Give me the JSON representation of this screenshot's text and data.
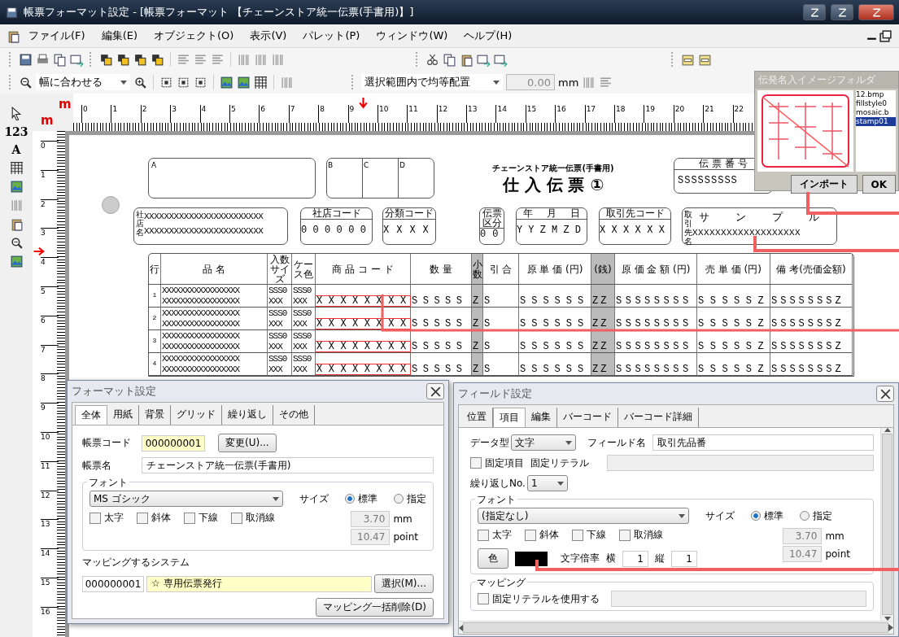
{
  "window": {
    "title": "帳票フォーマット設定 - [帳票フォーマット 【チェーンストア統一伝票(手書用)】]"
  },
  "menu": [
    "ファイル(F)",
    "編集(E)",
    "オブジェクト(O)",
    "表示(V)",
    "パレット(P)",
    "ウィンドウ(W)",
    "ヘルプ(H)"
  ],
  "toolbar": {
    "zoom_mode": "幅に合わせる",
    "distribute_mode": "選択範囲内で均等配置",
    "spacing": "0.00",
    "spacing_unit": "mm"
  },
  "palette": [
    "123",
    "A"
  ],
  "ruler": {
    "unit_marks": [
      "m",
      "m"
    ],
    "horizontal": [
      "0",
      "1",
      "2",
      "3",
      "4",
      "5",
      "6",
      "7",
      "8",
      "9",
      "10",
      "11",
      "12",
      "13",
      "14",
      "15",
      "16",
      "17",
      "18",
      "19",
      "20",
      "21",
      "22"
    ],
    "vertical": [
      "0",
      "1",
      "2",
      "3",
      "4",
      "5",
      "6",
      "7",
      "8",
      "9",
      "10",
      "11",
      "12",
      "13",
      "14",
      "15",
      "16"
    ]
  },
  "form": {
    "subtitle": "チェーンストア統一伝票(手書用)",
    "title": "仕 入 伝 票 ①",
    "corner_boxes": [
      "A",
      "B",
      "C",
      "D"
    ],
    "slip_number": {
      "label": "伝 票 番 号",
      "value": "SSSSSSSSS"
    },
    "store": {
      "label": "社店名",
      "lines": [
        "XXXXXXXXXXXXXXXXXXXXXXXX",
        "XXXXXXXXXXXXXXXXXXXXXXXX"
      ]
    },
    "code_boxes": [
      {
        "headers": [
          "社店コード"
        ],
        "digits": [
          "0",
          "0",
          "0",
          "0",
          "0",
          "0"
        ]
      },
      {
        "headers": [
          "分類コード"
        ],
        "digits": [
          "X",
          "X",
          "X",
          "X"
        ]
      },
      {
        "headers": [
          "伝票区分"
        ],
        "digits": [
          "0",
          "0"
        ]
      },
      {
        "headers": [
          "年",
          "月",
          "日"
        ],
        "digits": [
          "Y",
          "Y",
          "Z",
          "M",
          "Z",
          "D"
        ]
      },
      {
        "headers": [
          "取引先コード"
        ],
        "digits": [
          "X",
          "X",
          "X",
          "X",
          "X",
          "X"
        ]
      }
    ],
    "supplier": {
      "label": "取引先名",
      "sample": "サ ン プ ル",
      "value": "XXXXXXXXXXXXXXXXXXX"
    },
    "columns": [
      {
        "label": "行",
        "selected": false,
        "shaded": false
      },
      {
        "label": "品 名",
        "selected": false,
        "shaded": false
      },
      {
        "label": "入数サイズ",
        "selected": false,
        "shaded": false
      },
      {
        "label": "ケース色",
        "selected": false,
        "shaded": false
      },
      {
        "label": "商 品 コ ー ド",
        "selected": true,
        "shaded": false
      },
      {
        "label": "数 量",
        "selected": false,
        "shaded": false
      },
      {
        "label": "小数",
        "selected": false,
        "shaded": true
      },
      {
        "label": "引 合",
        "selected": false,
        "shaded": false
      },
      {
        "label": "原 単 価 (円)",
        "selected": false,
        "shaded": false
      },
      {
        "label": "(銭)",
        "selected": false,
        "shaded": true
      },
      {
        "label": "原 価 金 額 (円)",
        "selected": false,
        "shaded": false
      },
      {
        "label": "売 単 価 (円)",
        "selected": false,
        "shaded": false
      },
      {
        "label": "備 考(売価金額)",
        "selected": false,
        "shaded": false
      }
    ],
    "rows": [
      [
        [
          "1"
        ],
        [
          "XXXXXXXXXXXXXXXXX",
          "XXXXXXXXXXXXXXXXX"
        ],
        [
          "SSS0",
          "XXX"
        ],
        [
          "SSS0",
          "XXX"
        ],
        [
          "XXXXXXXX"
        ],
        [
          "SSSSS"
        ],
        [
          "Z"
        ],
        [
          "S"
        ],
        [
          "SSSSSS"
        ],
        [
          "ZZ"
        ],
        [
          "SSSSSSSS"
        ],
        [
          "SSSSSZ"
        ],
        [
          "SSSSSSSZ"
        ]
      ],
      [
        [
          "2"
        ],
        [
          "XXXXXXXXXXXXXXXXX",
          "XXXXXXXXXXXXXXXXX"
        ],
        [
          "SSS0",
          "XXX"
        ],
        [
          "SSS0",
          "XXX"
        ],
        [
          "XXXXXXXX"
        ],
        [
          "SSSSS"
        ],
        [
          "Z"
        ],
        [
          "S"
        ],
        [
          "SSSSSS"
        ],
        [
          "ZZ"
        ],
        [
          "SSSSSSSS"
        ],
        [
          "SSSSSZ"
        ],
        [
          "SSSSSSSZ"
        ]
      ],
      [
        [
          "3"
        ],
        [
          "XXXXXXXXXXXXXXXXX",
          "XXXXXXXXXXXXXXXXX"
        ],
        [
          "SSS0",
          "XXX"
        ],
        [
          "SSS0",
          "XXX"
        ],
        [
          "XXXXXXXX"
        ],
        [
          "SSSSS"
        ],
        [
          "Z"
        ],
        [
          "S"
        ],
        [
          "SSSSSS"
        ],
        [
          "ZZ"
        ],
        [
          "SSSSSSSS"
        ],
        [
          "SSSSSZ"
        ],
        [
          "SSSSSSSZ"
        ]
      ],
      [
        [
          "4"
        ],
        [
          "XXXXXXXXXXXXXXXXX",
          "XXXXXXXXXXXXXXXXX"
        ],
        [
          "SSS0",
          "XXX"
        ],
        [
          "SSS0",
          "XXX"
        ],
        [
          "XXXXXXXX"
        ],
        [
          "SSSSS"
        ],
        [
          "Z"
        ],
        [
          "S"
        ],
        [
          "SSSSSS"
        ],
        [
          "ZZ"
        ],
        [
          "SSSSSSSS"
        ],
        [
          "SSSSSZ"
        ],
        [
          "SSSSSSSZ"
        ]
      ]
    ]
  },
  "image_folder": {
    "title": "伝発名入イメージフォルダ",
    "files": [
      {
        "name": "12.bmp",
        "selected": false
      },
      {
        "name": "fillstyle0",
        "selected": false
      },
      {
        "name": "mosaic.b",
        "selected": false
      },
      {
        "name": "stamp01",
        "selected": true
      }
    ],
    "import_button": "インポート",
    "ok_button": "OK"
  },
  "format_dialog": {
    "title": "フォーマット設定",
    "tabs": [
      {
        "label": "全体",
        "selected": true
      },
      {
        "label": "用紙",
        "selected": false
      },
      {
        "label": "背景",
        "selected": false
      },
      {
        "label": "グリッド",
        "selected": false
      },
      {
        "label": "繰り返し",
        "selected": false
      },
      {
        "label": "その他",
        "selected": false
      }
    ],
    "code": {
      "label": "帳票コード",
      "value": "000000001",
      "button": "変更(U)..."
    },
    "name": {
      "label": "帳票名",
      "value": "チェーンストア統一伝票(手書用)"
    },
    "font": {
      "group": "フォント",
      "family": "MS ゴシック",
      "size_label": "サイズ",
      "size_options": [
        {
          "label": "標準",
          "selected": true
        },
        {
          "label": "指定",
          "selected": false
        }
      ],
      "styles": [
        {
          "label": "太字",
          "checked": false
        },
        {
          "label": "斜体",
          "checked": false
        },
        {
          "label": "下線",
          "checked": false
        },
        {
          "label": "取消線",
          "checked": false
        }
      ],
      "size_mm": "3.70",
      "mm_unit": "mm",
      "size_pt": "10.47",
      "pt_unit": "point"
    },
    "mapping": {
      "label": "マッピングするシステム",
      "code": "000000001",
      "name": "☆ 専用伝票発行",
      "select_button": "選択(M)...",
      "clear_button": "マッピング一括削除(D)"
    }
  },
  "field_dialog": {
    "title": "フィールド設定",
    "tabs": [
      {
        "label": "位置",
        "selected": false
      },
      {
        "label": "項目",
        "selected": true
      },
      {
        "label": "編集",
        "selected": false
      },
      {
        "label": "バーコード",
        "selected": false
      },
      {
        "label": "バーコード詳細",
        "selected": false
      }
    ],
    "data_type": {
      "label": "データ型",
      "value": "文字"
    },
    "field_name": {
      "label": "フィールド名",
      "value": "取引先品番"
    },
    "fixed_item": {
      "label": "固定項目",
      "checked": false
    },
    "fixed_literal": {
      "label": "固定リテラル"
    },
    "repeat": {
      "label": "繰り返しNo.",
      "value": "1"
    },
    "font": {
      "group": "フォント",
      "family": "(指定なし)",
      "size_label": "サイズ",
      "size_options": [
        {
          "label": "標準",
          "selected": true
        },
        {
          "label": "指定",
          "selected": false
        }
      ],
      "styles": [
        {
          "label": "太字",
          "checked": false
        },
        {
          "label": "斜体",
          "checked": false
        },
        {
          "label": "下線",
          "checked": false
        },
        {
          "label": "取消線",
          "checked": false
        }
      ],
      "size_mm": "3.70",
      "mm_unit": "mm",
      "size_pt": "10.47",
      "pt_unit": "point",
      "color_button": "色",
      "color": "#000000",
      "scale_label": "文字倍率",
      "h_label": "横",
      "h_value": "1",
      "v_label": "縦",
      "v_value": "1"
    },
    "mapping": {
      "group": "マッピング",
      "use_literal": {
        "label": "固定リテラルを使用する",
        "checked": false
      }
    }
  }
}
